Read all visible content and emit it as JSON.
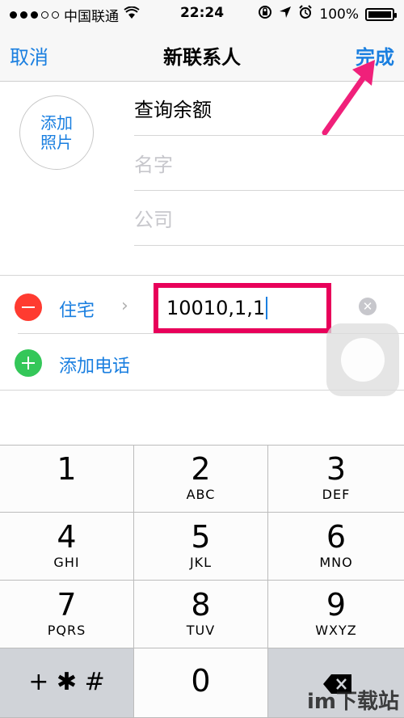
{
  "status_bar": {
    "carrier": "中国联通",
    "time": "22:24",
    "battery": "100%"
  },
  "nav": {
    "cancel": "取消",
    "title": "新联系人",
    "done": "完成"
  },
  "form": {
    "photo_line1": "添加",
    "photo_line2": "照片",
    "field1_value": "查询余额",
    "field2_placeholder": "名字",
    "field3_placeholder": "公司"
  },
  "phone": {
    "label": "住宅",
    "value": "10010,1,1",
    "add_label": "添加电话"
  },
  "keypad": {
    "keys": [
      {
        "num": "1",
        "letters": ""
      },
      {
        "num": "2",
        "letters": "ABC"
      },
      {
        "num": "3",
        "letters": "DEF"
      },
      {
        "num": "4",
        "letters": "GHI"
      },
      {
        "num": "5",
        "letters": "JKL"
      },
      {
        "num": "6",
        "letters": "MNO"
      },
      {
        "num": "7",
        "letters": "PQRS"
      },
      {
        "num": "8",
        "letters": "TUV"
      },
      {
        "num": "9",
        "letters": "WXYZ"
      },
      {
        "num": "0",
        "letters": ""
      }
    ],
    "symbols": "+ ✱ #"
  },
  "watermark": "im下载站",
  "colors": {
    "accent": "#1a7fe0",
    "highlight": "#e8005a",
    "remove": "#ff3b30",
    "add": "#34c759"
  }
}
